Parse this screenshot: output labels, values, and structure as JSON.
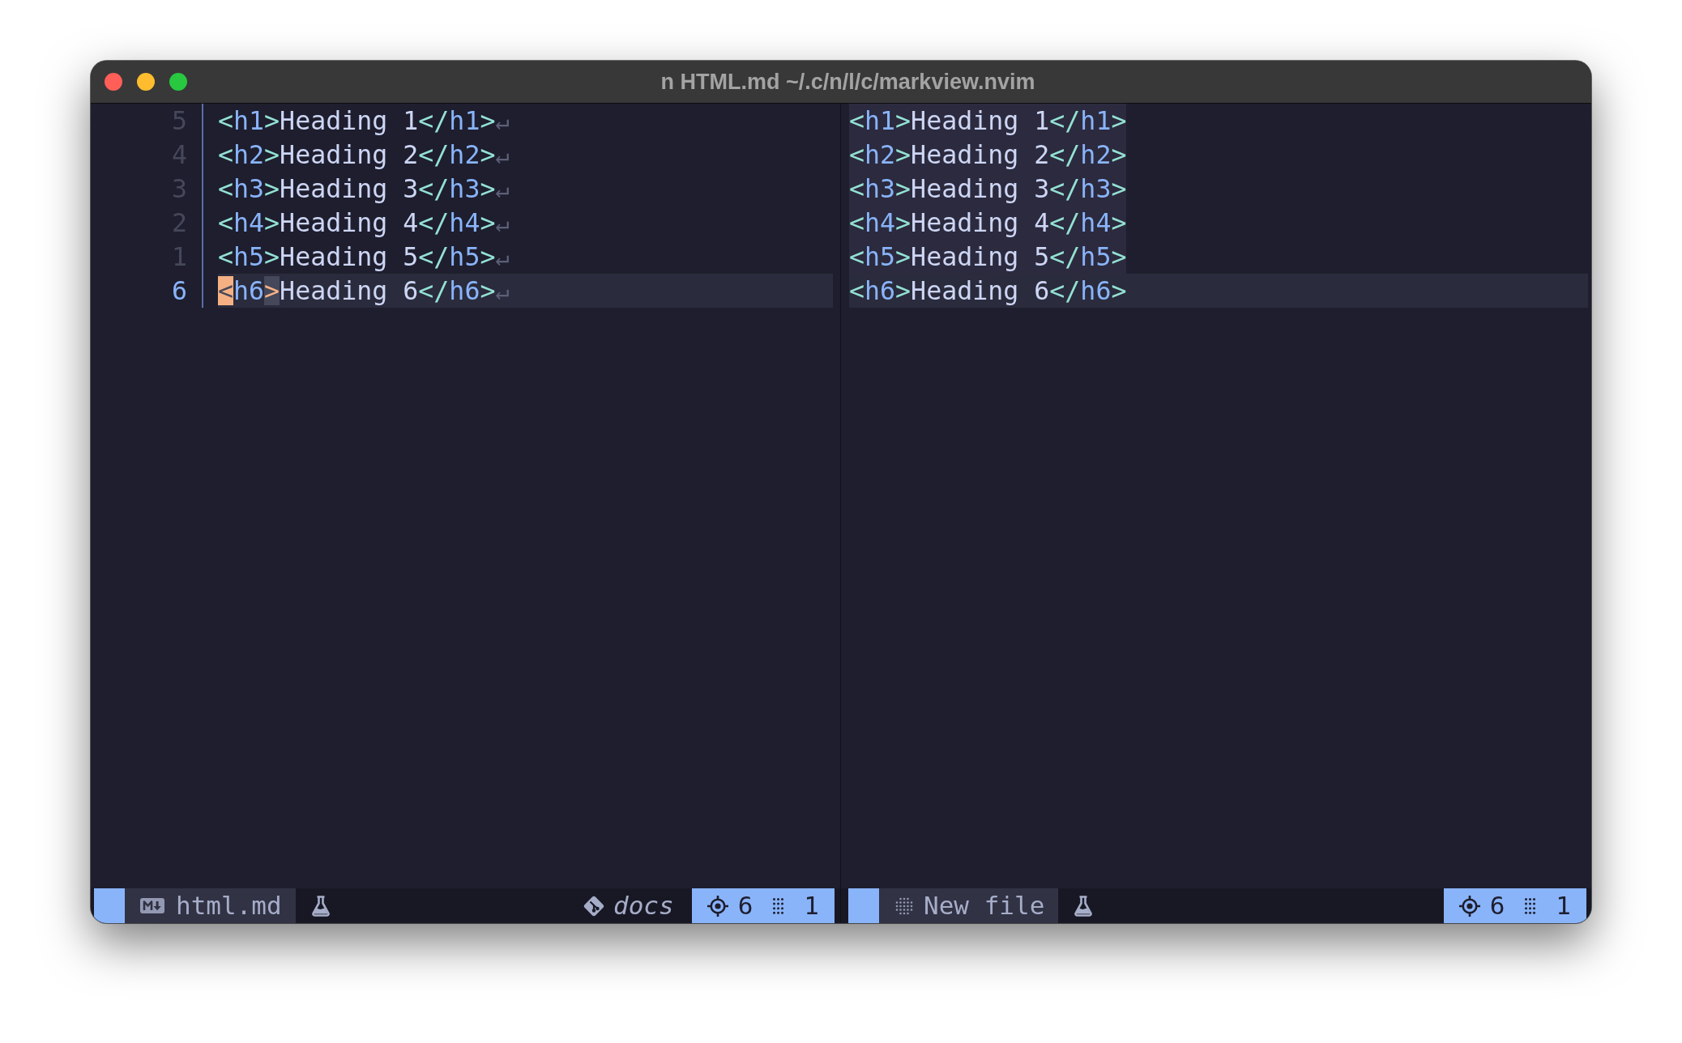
{
  "window": {
    "title": "n HTML.md ~/.c/n/l/c/markview.nvim"
  },
  "panes": [
    {
      "kind": "source",
      "lines": [
        {
          "number": "5",
          "current": false,
          "tokens": [
            {
              "kind": "bracket",
              "text": "<"
            },
            {
              "kind": "tag",
              "text": "h1"
            },
            {
              "kind": "bracket",
              "text": ">"
            },
            {
              "kind": "text",
              "text": "Heading 1"
            },
            {
              "kind": "bracket",
              "text": "</"
            },
            {
              "kind": "tag",
              "text": "h1"
            },
            {
              "kind": "bracket",
              "text": ">"
            },
            {
              "kind": "eol",
              "text": "↵"
            }
          ]
        },
        {
          "number": "4",
          "current": false,
          "tokens": [
            {
              "kind": "bracket",
              "text": "<"
            },
            {
              "kind": "tag",
              "text": "h2"
            },
            {
              "kind": "bracket",
              "text": ">"
            },
            {
              "kind": "text",
              "text": "Heading 2"
            },
            {
              "kind": "bracket",
              "text": "</"
            },
            {
              "kind": "tag",
              "text": "h2"
            },
            {
              "kind": "bracket",
              "text": ">"
            },
            {
              "kind": "eol",
              "text": "↵"
            }
          ]
        },
        {
          "number": "3",
          "current": false,
          "tokens": [
            {
              "kind": "bracket",
              "text": "<"
            },
            {
              "kind": "tag",
              "text": "h3"
            },
            {
              "kind": "bracket",
              "text": ">"
            },
            {
              "kind": "text",
              "text": "Heading 3"
            },
            {
              "kind": "bracket",
              "text": "</"
            },
            {
              "kind": "tag",
              "text": "h3"
            },
            {
              "kind": "bracket",
              "text": ">"
            },
            {
              "kind": "eol",
              "text": "↵"
            }
          ]
        },
        {
          "number": "2",
          "current": false,
          "tokens": [
            {
              "kind": "bracket",
              "text": "<"
            },
            {
              "kind": "tag",
              "text": "h4"
            },
            {
              "kind": "bracket",
              "text": ">"
            },
            {
              "kind": "text",
              "text": "Heading 4"
            },
            {
              "kind": "bracket",
              "text": "</"
            },
            {
              "kind": "tag",
              "text": "h4"
            },
            {
              "kind": "bracket",
              "text": ">"
            },
            {
              "kind": "eol",
              "text": "↵"
            }
          ]
        },
        {
          "number": "1",
          "current": false,
          "tokens": [
            {
              "kind": "bracket",
              "text": "<"
            },
            {
              "kind": "tag",
              "text": "h5"
            },
            {
              "kind": "bracket",
              "text": ">"
            },
            {
              "kind": "text",
              "text": "Heading 5"
            },
            {
              "kind": "bracket",
              "text": "</"
            },
            {
              "kind": "tag",
              "text": "h5"
            },
            {
              "kind": "bracket",
              "text": ">"
            },
            {
              "kind": "eol",
              "text": "↵"
            }
          ]
        },
        {
          "number": "6",
          "current": true,
          "tokens": [
            {
              "kind": "cursor",
              "text": "<"
            },
            {
              "kind": "tag",
              "text": "h6"
            },
            {
              "kind": "match",
              "text": ">"
            },
            {
              "kind": "text",
              "text": "Heading 6"
            },
            {
              "kind": "bracket",
              "text": "</"
            },
            {
              "kind": "tag",
              "text": "h6"
            },
            {
              "kind": "bracket",
              "text": ">"
            },
            {
              "kind": "eol",
              "text": "↵"
            }
          ]
        }
      ],
      "status_bar": {
        "file": {
          "kind": "markdown",
          "name": "html.md"
        },
        "branch": "docs",
        "line": "6",
        "column": "1"
      }
    },
    {
      "kind": "preview",
      "lines": [
        {
          "current": false,
          "tokens": [
            {
              "kind": "bracket",
              "text": "<"
            },
            {
              "kind": "tag",
              "text": "h1"
            },
            {
              "kind": "bracket",
              "text": ">"
            },
            {
              "kind": "text",
              "text": "Heading 1"
            },
            {
              "kind": "bracket",
              "text": "</"
            },
            {
              "kind": "tag",
              "text": "h1"
            },
            {
              "kind": "bracket",
              "text": ">"
            }
          ]
        },
        {
          "current": false,
          "tokens": [
            {
              "kind": "bracket",
              "text": "<"
            },
            {
              "kind": "tag",
              "text": "h2"
            },
            {
              "kind": "bracket",
              "text": ">"
            },
            {
              "kind": "text",
              "text": "Heading 2"
            },
            {
              "kind": "bracket",
              "text": "</"
            },
            {
              "kind": "tag",
              "text": "h2"
            },
            {
              "kind": "bracket",
              "text": ">"
            }
          ]
        },
        {
          "current": false,
          "tokens": [
            {
              "kind": "bracket",
              "text": "<"
            },
            {
              "kind": "tag",
              "text": "h3"
            },
            {
              "kind": "bracket",
              "text": ">"
            },
            {
              "kind": "text",
              "text": "Heading 3"
            },
            {
              "kind": "bracket",
              "text": "</"
            },
            {
              "kind": "tag",
              "text": "h3"
            },
            {
              "kind": "bracket",
              "text": ">"
            }
          ]
        },
        {
          "current": false,
          "tokens": [
            {
              "kind": "bracket",
              "text": "<"
            },
            {
              "kind": "tag",
              "text": "h4"
            },
            {
              "kind": "bracket",
              "text": ">"
            },
            {
              "kind": "text",
              "text": "Heading 4"
            },
            {
              "kind": "bracket",
              "text": "</"
            },
            {
              "kind": "tag",
              "text": "h4"
            },
            {
              "kind": "bracket",
              "text": ">"
            }
          ]
        },
        {
          "current": false,
          "tokens": [
            {
              "kind": "bracket",
              "text": "<"
            },
            {
              "kind": "tag",
              "text": "h5"
            },
            {
              "kind": "bracket",
              "text": ">"
            },
            {
              "kind": "text",
              "text": "Heading 5"
            },
            {
              "kind": "bracket",
              "text": "</"
            },
            {
              "kind": "tag",
              "text": "h5"
            },
            {
              "kind": "bracket",
              "text": ">"
            }
          ]
        },
        {
          "current": true,
          "tokens": [
            {
              "kind": "bracket",
              "text": "<"
            },
            {
              "kind": "tag",
              "text": "h6"
            },
            {
              "kind": "bracket",
              "text": ">"
            },
            {
              "kind": "text",
              "text": "Heading 6"
            },
            {
              "kind": "bracket",
              "text": "</"
            },
            {
              "kind": "tag",
              "text": "h6"
            },
            {
              "kind": "bracket",
              "text": ">"
            }
          ]
        }
      ],
      "status_bar": {
        "file": {
          "kind": "new",
          "name": "New file"
        },
        "line": "6",
        "column": "1"
      }
    }
  ]
}
